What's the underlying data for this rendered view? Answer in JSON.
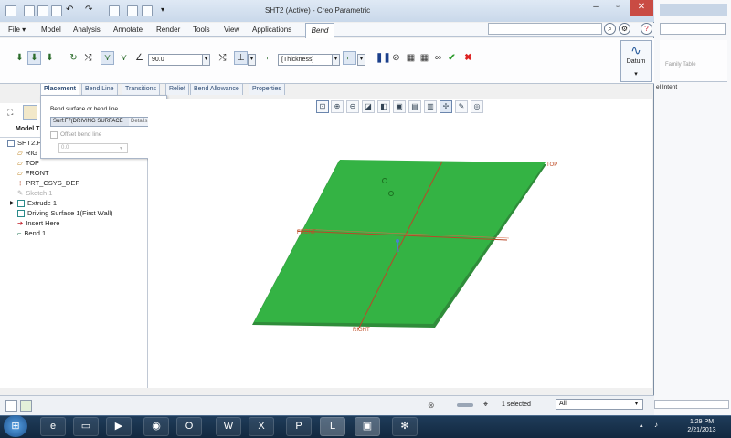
{
  "window": {
    "title": "SHT2 (Active) - Creo Parametric"
  },
  "menu": {
    "file": "File",
    "file_arrow": "▾",
    "tabs": [
      "Model",
      "Analysis",
      "Annotate",
      "Render",
      "Tools",
      "View",
      "Applications"
    ],
    "active_tab": "Bend"
  },
  "ribbon": {
    "angle_value": "90.0",
    "thickness_option": "[Thickness]",
    "datum_label": "Datum"
  },
  "subtabs": [
    "Placement",
    "Bend Line",
    "Transitions",
    "Relief",
    "Bend Allowance",
    "Properties"
  ],
  "placement_panel": {
    "label": "Bend surface or bend line",
    "collector_value": "Surf:F7(DRIVING SURFACE",
    "details_button": "Details...",
    "offset_label": "Offset bend line",
    "offset_value": "0.0"
  },
  "model_tree": {
    "header": "Model T",
    "items": [
      "SHT2.P",
      "RIG",
      "TOP",
      "FRONT",
      "PRT_CSYS_DEF",
      "Sketch 1",
      "Extrude 1",
      "Driving Surface 1(First Wall)",
      "Insert Here",
      "Bend 1"
    ]
  },
  "graphics": {
    "labels": {
      "top": "TOP",
      "front": "FRONT",
      "right": "RIGHT"
    },
    "plate_color": "#34b344"
  },
  "status": {
    "selected": "1 selected",
    "filter": "All"
  },
  "background_window": {
    "family_table": "Family Table",
    "intent_label": "el Intent"
  },
  "taskbar": {
    "time": "1:29 PM",
    "date": "2/21/2013"
  }
}
